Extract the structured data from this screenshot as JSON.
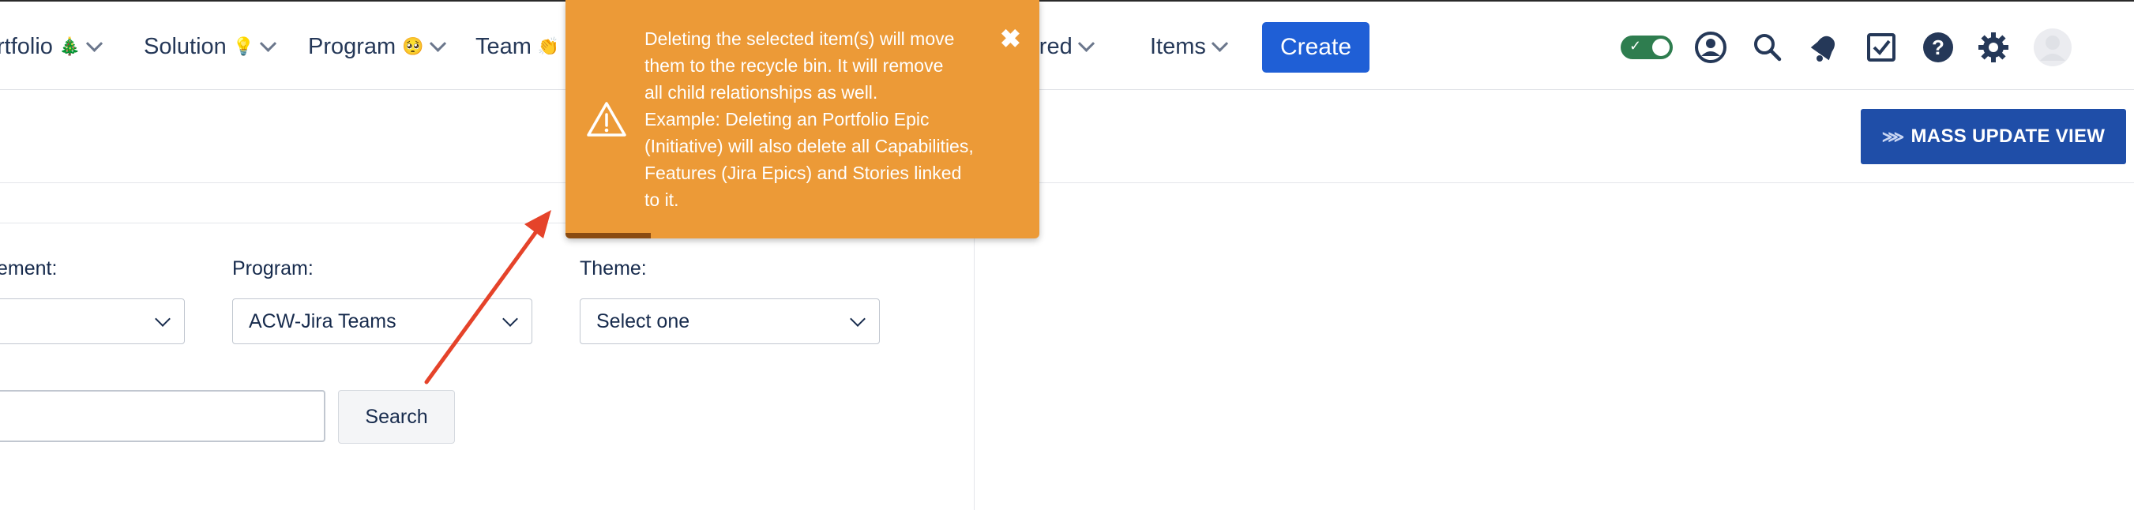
{
  "nav": {
    "items": [
      {
        "label": "rtfolio",
        "emoji": "🎄"
      },
      {
        "label": "Solution",
        "emoji": "💡"
      },
      {
        "label": "Program",
        "emoji": "🥺"
      },
      {
        "label": "Team",
        "emoji": "👏"
      },
      {
        "label": "arred",
        "emoji": ""
      },
      {
        "label": "Items",
        "emoji": ""
      }
    ],
    "create_label": "Create",
    "icons": [
      "toggle-icon",
      "user-circle-icon",
      "search-icon",
      "notification-bell-icon",
      "checkbox-icon",
      "help-icon",
      "settings-gear-icon",
      "avatar"
    ]
  },
  "toolbar": {
    "mass_update_label": "MASS UPDATE VIEW",
    "mass_update_prefix": "⋙"
  },
  "filters": {
    "first_label": "ement:",
    "program_label": "Program:",
    "program_value": "ACW-Jira Teams",
    "theme_label": "Theme:",
    "theme_value": "Select one",
    "search_label": "Search"
  },
  "toast": {
    "lines": [
      "Deleting the selected item(s) will move",
      "them to the recycle bin. It will remove",
      "all child relationships as well.",
      "Example: Deleting an Portfolio Epic",
      "(Initiative) will also delete all Capabilities,",
      "Features (Jira Epics) and Stories linked",
      "to it."
    ],
    "close_symbol": "✖",
    "progress_fraction": 0.18,
    "background_color": "#ec9a37"
  },
  "colors": {
    "accent": "#1f5fd6",
    "mass_update": "#1f4ea8",
    "toggle": "#2e7d4f",
    "annotation_arrow": "#e5432a"
  }
}
